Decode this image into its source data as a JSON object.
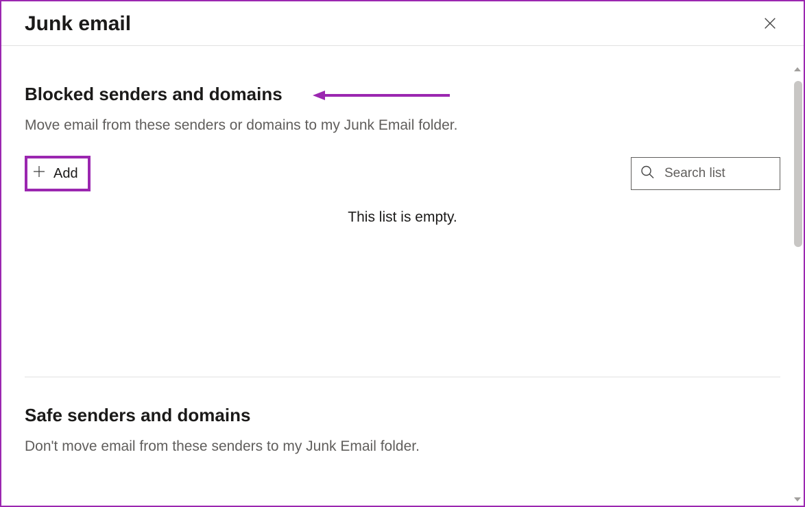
{
  "header": {
    "title": "Junk email"
  },
  "sections": {
    "blocked": {
      "title": "Blocked senders and domains",
      "description": "Move email from these senders or domains to my Junk Email folder.",
      "add_label": "Add",
      "search_placeholder": "Search list",
      "empty_message": "This list is empty."
    },
    "safe": {
      "title": "Safe senders and domains",
      "description": "Don't move email from these senders to my Junk Email folder."
    }
  },
  "annotations": {
    "arrow_color": "#9b27b0",
    "highlight_color": "#9b27b0"
  }
}
